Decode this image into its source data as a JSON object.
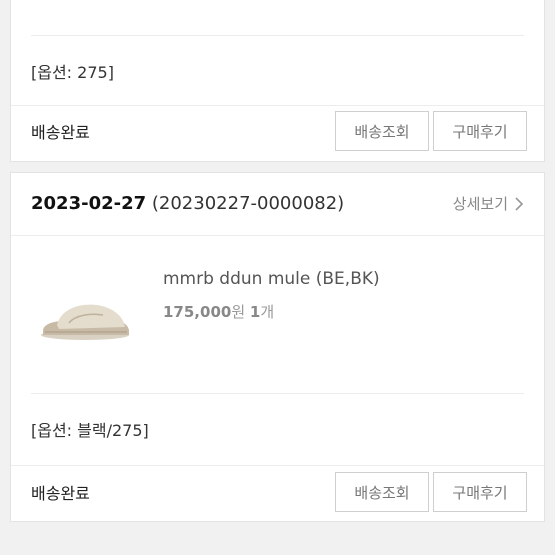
{
  "prev_order": {
    "option": "[옵션: 275]",
    "status": "배송완료",
    "tracking_button": "배송조회",
    "review_button": "구매후기"
  },
  "order": {
    "date": "2023-02-27",
    "order_number": "(20230227-0000082)",
    "detail_link": "상세보기",
    "product": {
      "name": "mmrb ddun mule (BE,BK)",
      "price": "175,000",
      "price_unit": "원",
      "quantity": "1",
      "quantity_unit": "개"
    },
    "option": "[옵션: 블랙/275]",
    "status": "배송완료",
    "tracking_button": "배송조회",
    "review_button": "구매후기"
  }
}
